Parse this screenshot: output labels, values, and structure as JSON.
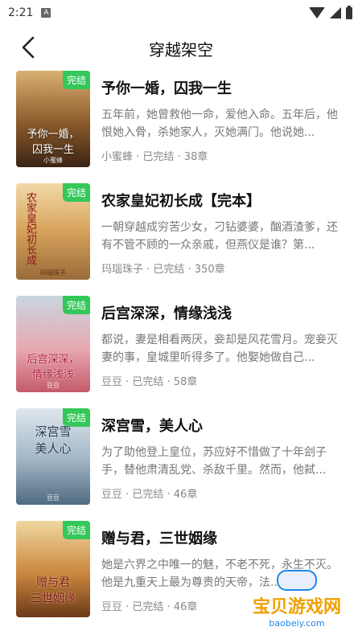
{
  "status": {
    "time": "2:21",
    "a_icon": "A"
  },
  "header": {
    "title": "穿越架空"
  },
  "colors": {
    "badge": "#34c759",
    "watermark_title": "#f0a000"
  },
  "books": [
    {
      "title": "予你一婚，囚我一生",
      "desc": "五年前，她曾救他一命，爱他入命。五年后，他恨她入骨，杀她家人，灭她满门。他说她...",
      "meta": "小蜜蜂 · 已完结 · 38章",
      "badge": "完结",
      "cover_text": "予你一婚，\n囚我一生",
      "cover_author": "小蜜蜂"
    },
    {
      "title": "农家皇妃初长成【完本】",
      "desc": "一朝穿越成穷苦少女，刁钻婆婆，酗酒渣爹，还有不管不顾的一众亲戚，但燕仪是谁？第...",
      "meta": "玛瑙珠子 · 已完结 · 350章",
      "badge": "完结",
      "cover_text": "农家皇妃初长成",
      "cover_author": "玛瑙珠子"
    },
    {
      "title": "后宫深深，情缘浅浅",
      "desc": "都说，妻是相看两厌，妾却是风花雪月。宠妾灭妻的事，皇城里听得多了。他娶她做自己...",
      "meta": "豆豆 · 已完结 · 58章",
      "badge": "完结",
      "cover_text": "后宫深深，\n情缘浅浅",
      "cover_author": "豆豆"
    },
    {
      "title": "深宫雪，美人心",
      "desc": "为了助他登上皇位，苏应好不惜做了十年刽子手，替他肃清乱党、杀敌千里。然而，他弑...",
      "meta": "豆豆 · 已完结 · 46章",
      "badge": "完结",
      "cover_text": "深宫雪\n美人心",
      "cover_author": "豆豆"
    },
    {
      "title": "赠与君，三世姻缘",
      "desc": "她是六界之中唯一的魅，不老不死，永生不灭。他是九重天上最为尊贵的天帝，法...",
      "meta": "豆豆 · 已完结 · 46章",
      "badge": "完结",
      "cover_text": "赠与君\n三世姻缘",
      "cover_author": ""
    }
  ],
  "watermark": {
    "title": "宝贝游戏网",
    "url": "baobeiy.com"
  }
}
